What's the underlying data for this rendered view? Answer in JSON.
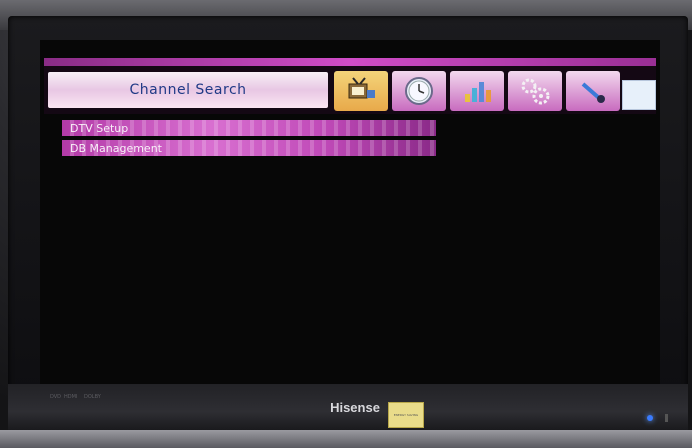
{
  "osd": {
    "title": "Channel Search",
    "icons": [
      {
        "name": "channel-icon",
        "label": ""
      },
      {
        "name": "clock-icon",
        "label": ""
      },
      {
        "name": "picture-icon",
        "label": ""
      },
      {
        "name": "settings-gears-icon",
        "label": ""
      },
      {
        "name": "lock-icon",
        "label": ""
      }
    ],
    "menu_items": [
      {
        "label": "DTV Setup"
      },
      {
        "label": "DB Management"
      }
    ]
  },
  "tv": {
    "brand": "Hisense",
    "bezel_labels": [
      "DVD",
      "HDMI",
      "DOLBY"
    ],
    "sticker_title": "ENERGY SAVING"
  },
  "colors": {
    "accent_magenta": "#c04ab8",
    "title_text": "#203a86",
    "screen_background": "#070707"
  }
}
